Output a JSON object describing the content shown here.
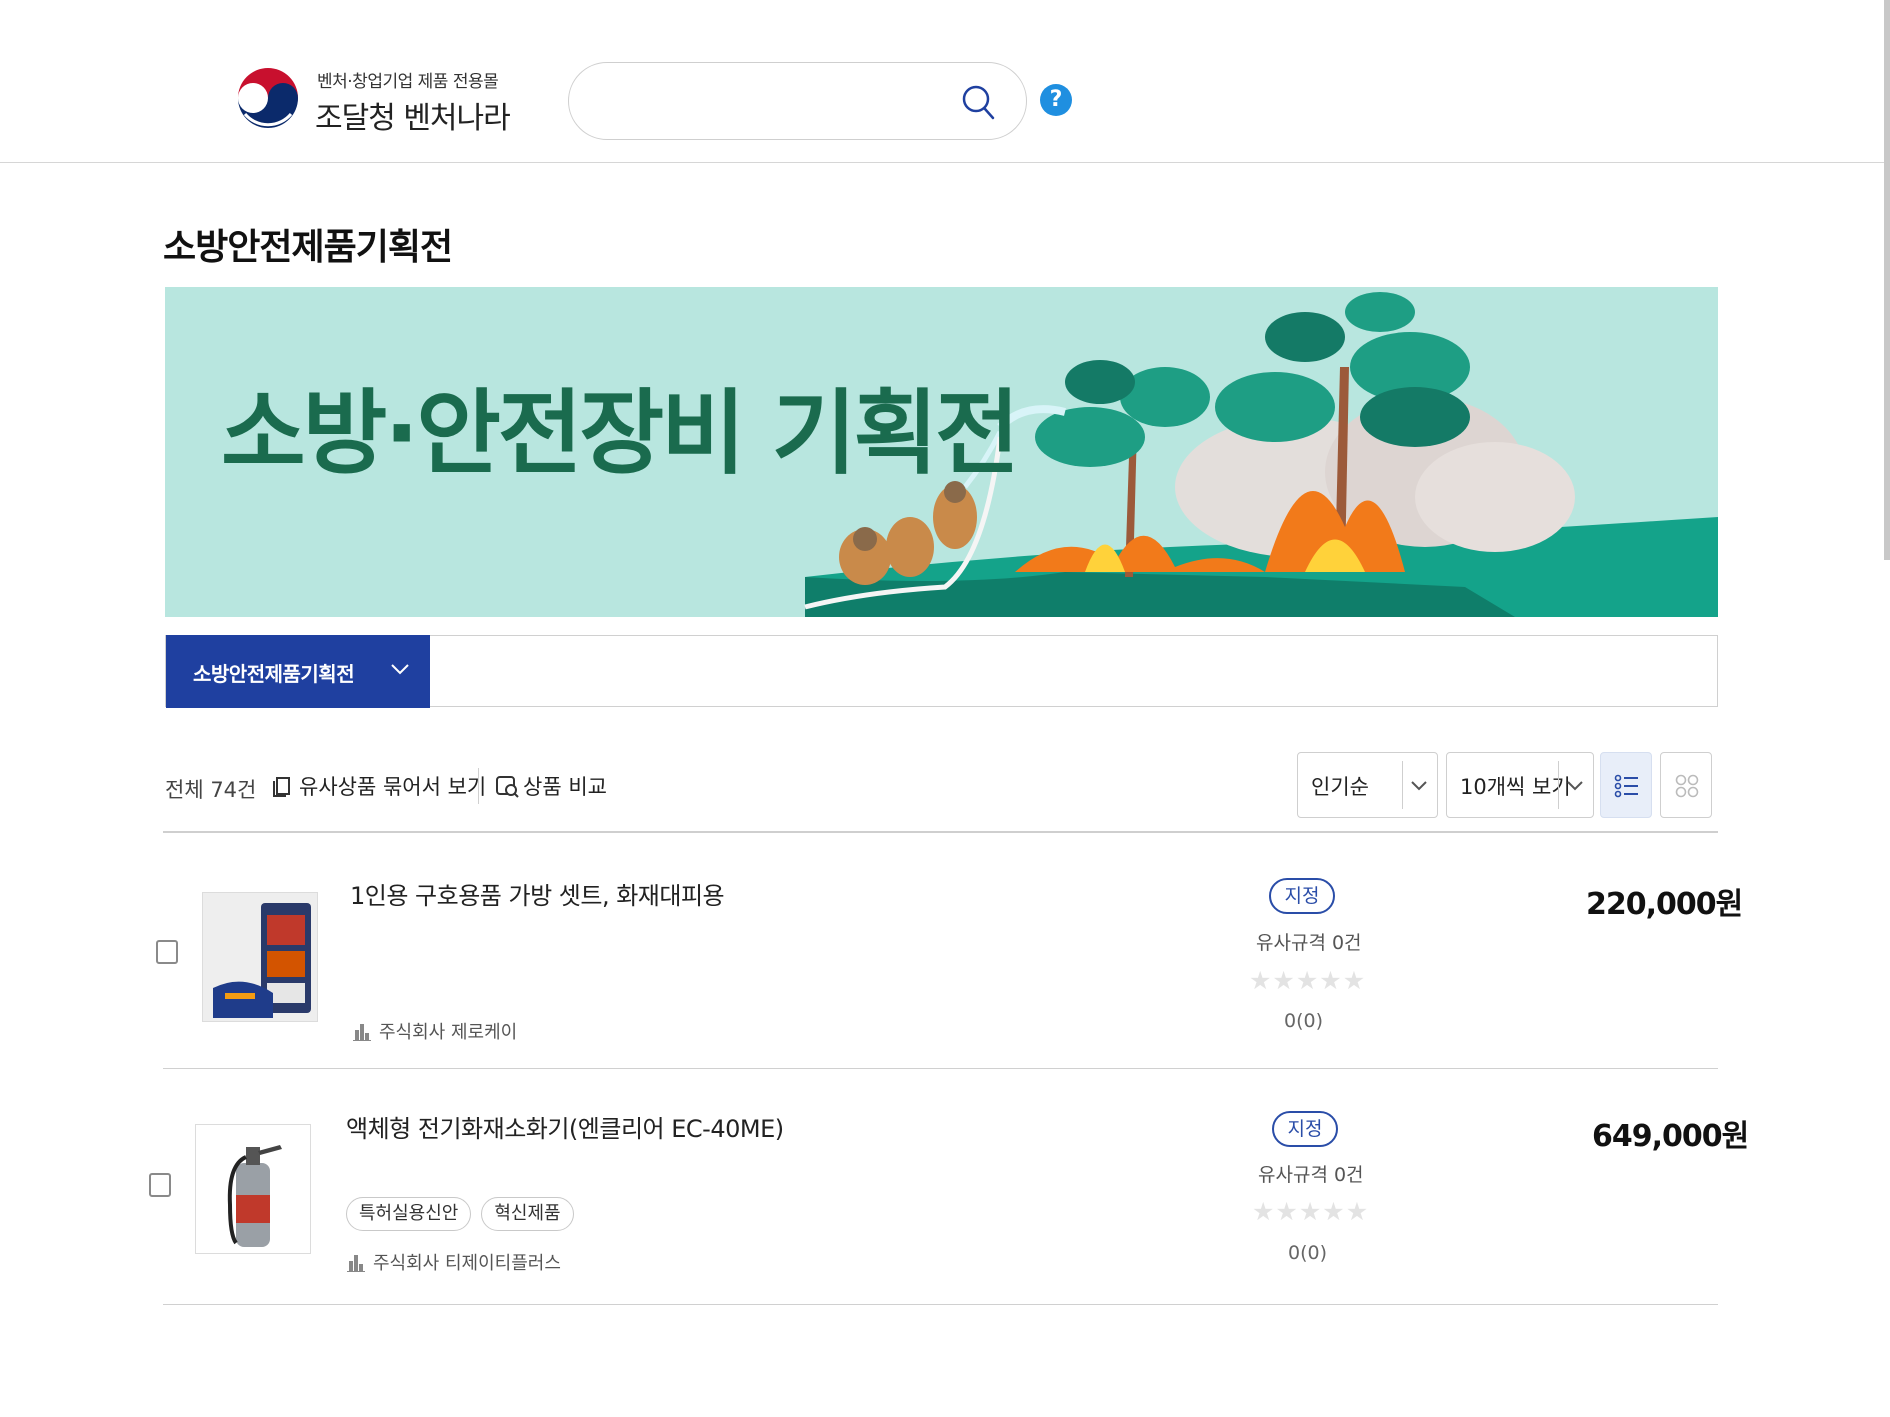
{
  "header": {
    "logo_sub": "벤처·창업기업 제품 전용몰",
    "logo_main": "조달청 벤처나라",
    "search_placeholder": "",
    "help_label": "?"
  },
  "page": {
    "title": "소방안전제품기획전"
  },
  "banner": {
    "headline": "소방·안전장비 기획전"
  },
  "category": {
    "selected": "소방안전제품기획전"
  },
  "toolbar": {
    "total": "전체 74건",
    "group_similar": "유사상품 묶어서 보기",
    "compare": "상품 비교",
    "sort_selected": "인기순",
    "page_size_selected": "10개씩 보기"
  },
  "products": [
    {
      "name": "1인용 구호용품 가방 셋트, 화재대피용",
      "seller": "주식회사 제로케이",
      "tags": [],
      "badge": "지정",
      "similar": "유사규격 0건",
      "rating_text": "0(0)",
      "stars_filled": 0,
      "price": "220,000원"
    },
    {
      "name": "액체형 전기화재소화기(엔클리어 EC-40ME)",
      "seller": "주식회사 티제이티플러스",
      "tags": [
        "특허실용신안",
        "혁신제품"
      ],
      "badge": "지정",
      "similar": "유사규격 0건",
      "rating_text": "0(0)",
      "stars_filled": 0,
      "price": "649,000원"
    }
  ],
  "colors": {
    "brand_blue": "#1f40a0",
    "badge_blue": "#2a4da8",
    "banner_bg": "#b8e6df",
    "banner_text": "#1a6b4e",
    "help_blue": "#1f8fe0"
  }
}
